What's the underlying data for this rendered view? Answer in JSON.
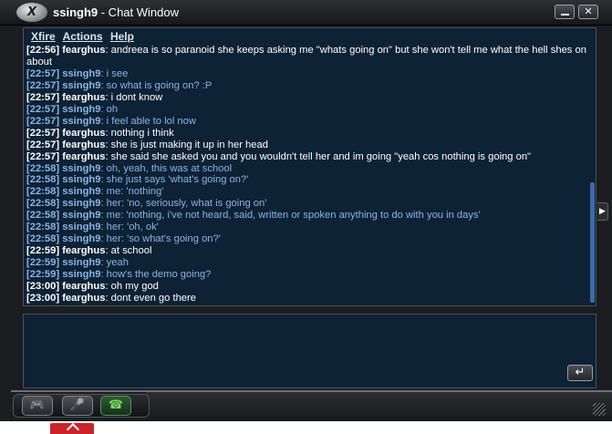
{
  "window": {
    "user": "ssingh9",
    "title_suffix": " - Chat Window",
    "logo_text": "X"
  },
  "menu": [
    "Xfire",
    "Actions",
    "Help"
  ],
  "icons": {
    "logo": "xfire-logo-icon",
    "minimize": "minimize-icon",
    "close": "close-icon",
    "send": "send-enter-icon",
    "game": "gamepad-icon",
    "mic": "microphone-icon",
    "call": "phone-icon",
    "side": "chevron-right-icon"
  },
  "glyphs": {
    "close": "✕",
    "send": "↵",
    "game": "🎮",
    "mic": "🎤",
    "call": "☎",
    "side": "▶"
  },
  "colors": {
    "chat_bg": "#0d2235",
    "them_text": "#ffffff",
    "me_text": "#8ab4e4",
    "scroll_thumb": "#3d6aa6"
  },
  "messages": [
    {
      "time": "[22:56]",
      "who": "fearghus",
      "text": ": andreea is so paranoid she keeps asking me \"whats going on\" but she won't tell me what the hell shes on about",
      "self": false
    },
    {
      "time": "[22:57]",
      "who": "ssingh9",
      "text": ": i see",
      "self": true
    },
    {
      "time": "[22:57]",
      "who": "ssingh9",
      "text": ": so what is going on? :P",
      "self": true
    },
    {
      "time": "[22:57]",
      "who": "fearghus",
      "text": ": i dont know",
      "self": false
    },
    {
      "time": "[22:57]",
      "who": "ssingh9",
      "text": ": oh",
      "self": true
    },
    {
      "time": "[22:57]",
      "who": "ssingh9",
      "text": ": i feel able to lol now",
      "self": true
    },
    {
      "time": "[22:57]",
      "who": "fearghus",
      "text": ": nothing i think",
      "self": false
    },
    {
      "time": "[22:57]",
      "who": "fearghus",
      "text": ": she is just making it up in her head",
      "self": false
    },
    {
      "time": "[22:57]",
      "who": "fearghus",
      "text": ": she said she asked you and you wouldn't tell her and im going \"yeah cos nothing is going on\"",
      "self": false
    },
    {
      "time": "[22:58]",
      "who": "ssingh9",
      "text": ": oh, yeah, this was at school",
      "self": true
    },
    {
      "time": "[22:58]",
      "who": "ssingh9",
      "text": ": she just says 'what's going on?'",
      "self": true
    },
    {
      "time": "[22:58]",
      "who": "ssingh9",
      "text": ": me: 'nothing'",
      "self": true
    },
    {
      "time": "[22:58]",
      "who": "ssingh9",
      "text": ": her: 'no, seriously, what is going on'",
      "self": true
    },
    {
      "time": "[22:58]",
      "who": "ssingh9",
      "text": ": me: 'nothing, i've not heard, said, written or spoken anything to do with you in days'",
      "self": true
    },
    {
      "time": "[22:58]",
      "who": "ssingh9",
      "text": ": her: 'oh, ok'",
      "self": true
    },
    {
      "time": "[22:58]",
      "who": "ssingh9",
      "text": ": her: 'so what's going on?'",
      "self": true
    },
    {
      "time": "[22:59]",
      "who": "fearghus",
      "text": ": at school",
      "self": false
    },
    {
      "time": "[22:59]",
      "who": "ssingh9",
      "text": ": yeah",
      "self": true
    },
    {
      "time": "[22:59]",
      "who": "ssingh9",
      "text": ": how's the demo going?",
      "self": true
    },
    {
      "time": "[23:00]",
      "who": "fearghus",
      "text": ": oh my god",
      "self": false
    },
    {
      "time": "[23:00]",
      "who": "fearghus",
      "text": ": dont even go there",
      "self": false
    }
  ],
  "input": {
    "value": "",
    "placeholder": ""
  },
  "scroll": {
    "position_fraction": 1.0
  }
}
